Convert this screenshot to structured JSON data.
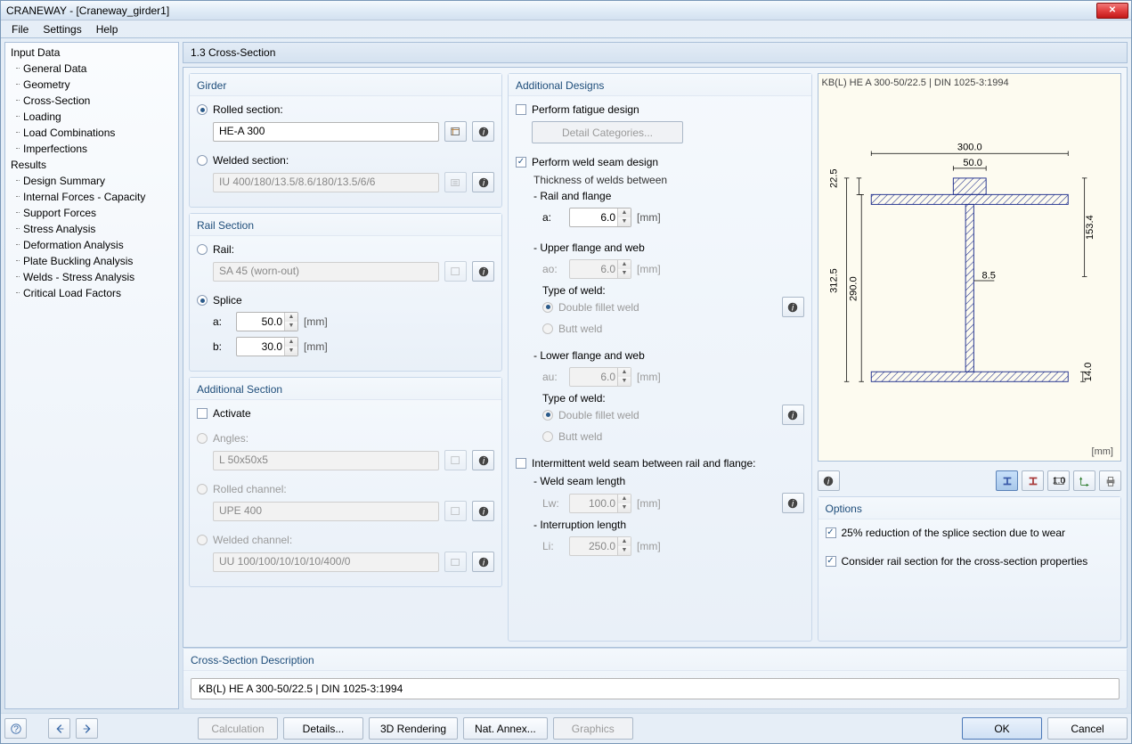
{
  "window_title": "CRANEWAY - [Craneway_girder1]",
  "menu": [
    "File",
    "Settings",
    "Help"
  ],
  "tree": {
    "input": {
      "label": "Input Data",
      "items": [
        "General Data",
        "Geometry",
        "Cross-Section",
        "Loading",
        "Load Combinations",
        "Imperfections"
      ]
    },
    "results": {
      "label": "Results",
      "items": [
        "Design Summary",
        "Internal Forces - Capacity",
        "Support Forces",
        "Stress Analysis",
        "Deformation Analysis",
        "Plate Buckling Analysis",
        "Welds - Stress Analysis",
        "Critical Load Factors"
      ]
    }
  },
  "main_header": "1.3 Cross-Section",
  "girder": {
    "title": "Girder",
    "rolled_label": "Rolled section:",
    "rolled_value": "HE-A 300",
    "welded_label": "Welded section:",
    "welded_value": "IU 400/180/13.5/8.6/180/13.5/6/6"
  },
  "rail": {
    "title": "Rail Section",
    "rail_label": "Rail:",
    "rail_value": "SA 45 (worn-out)",
    "splice_label": "Splice",
    "a_label": "a:",
    "a_val": "50.0",
    "b_label": "b:",
    "b_val": "30.0",
    "unit": "[mm]"
  },
  "addsec": {
    "title": "Additional Section",
    "activate": "Activate",
    "angles_label": "Angles:",
    "angles_value": "L 50x50x5",
    "rolled_ch_label": "Rolled channel:",
    "rolled_ch_value": "UPE 400",
    "welded_ch_label": "Welded channel:",
    "welded_ch_value": "UU 100/100/10/10/10/400/0"
  },
  "adddes": {
    "title": "Additional Designs",
    "fatigue": "Perform fatigue design",
    "detail_btn": "Detail Categories...",
    "weld_seam": "Perform weld seam design",
    "thickness_hdr": "Thickness of welds between",
    "rail_flange": "- Rail and flange",
    "a_label": "a:",
    "a_val": "6.0",
    "upper": "- Upper flange and web",
    "ao_label": "ao:",
    "ao_val": "6.0",
    "lower": "- Lower flange and web",
    "au_label": "au:",
    "au_val": "6.0",
    "type_label": "Type of weld:",
    "fillet": "Double fillet weld",
    "butt": "Butt weld",
    "intermittent": "Intermittent weld seam between rail and flange:",
    "weld_len_hdr": "- Weld seam length",
    "lw_label": "Lw:",
    "lw_val": "100.0",
    "int_len_hdr": "- Interruption length",
    "li_label": "Li:",
    "li_val": "250.0",
    "unit": "[mm]"
  },
  "desc": {
    "title": "Cross-Section Description",
    "value": "KB(L) HE A 300-50/22.5 | DIN 1025-3:1994"
  },
  "preview": {
    "title": "KB(L) HE A 300-50/22.5 | DIN 1025-3:1994",
    "dims": {
      "w": "300.0",
      "w2": "50.0",
      "h1": "22.5",
      "h2": "312.5",
      "h3": "290.0",
      "h4": "153.4",
      "h5": "14.0",
      "t": "8.5"
    },
    "unit": "[mm]"
  },
  "options": {
    "title": "Options",
    "opt1": "25% reduction of the splice section due to wear",
    "opt2": "Consider rail section for the cross-section properties"
  },
  "footer": {
    "calc": "Calculation",
    "details": "Details...",
    "render": "3D Rendering",
    "annex": "Nat. Annex...",
    "graphics": "Graphics",
    "ok": "OK",
    "cancel": "Cancel"
  }
}
